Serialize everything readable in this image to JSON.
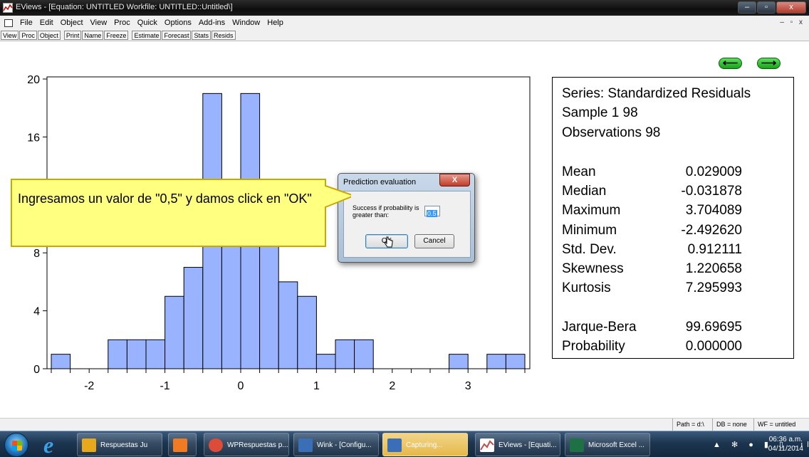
{
  "window": {
    "title": "EViews - [Equation: UNTITLED   Workfile: UNTITLED::Untitled\\]",
    "minimize": "–",
    "maximize": "▫",
    "close": "x"
  },
  "menu": {
    "items": [
      "File",
      "Edit",
      "Object",
      "View",
      "Proc",
      "Quick",
      "Options",
      "Add-ins",
      "Window",
      "Help"
    ],
    "mdi_controls": "– ▫ x"
  },
  "toolbar": {
    "buttons": [
      "View",
      "Proc",
      "Object",
      "Print",
      "Name",
      "Freeze",
      "Estimate",
      "Forecast",
      "Stats",
      "Resids"
    ]
  },
  "nav": {
    "back": "⟵",
    "forward": "⟶"
  },
  "chart_data": {
    "type": "bar",
    "subtype": "histogram",
    "bin_width": 0.25,
    "bins": [
      {
        "x0": -2.5,
        "x1": -2.25,
        "count": 1
      },
      {
        "x0": -2.25,
        "x1": -2.0,
        "count": 0
      },
      {
        "x0": -2.0,
        "x1": -1.75,
        "count": 0
      },
      {
        "x0": -1.75,
        "x1": -1.5,
        "count": 2
      },
      {
        "x0": -1.5,
        "x1": -1.25,
        "count": 2
      },
      {
        "x0": -1.25,
        "x1": -1.0,
        "count": 2
      },
      {
        "x0": -1.0,
        "x1": -0.75,
        "count": 5
      },
      {
        "x0": -0.75,
        "x1": -0.5,
        "count": 7
      },
      {
        "x0": -0.5,
        "x1": -0.25,
        "count": 19
      },
      {
        "x0": -0.25,
        "x1": 0.0,
        "count": 9
      },
      {
        "x0": 0.0,
        "x1": 0.25,
        "count": 19
      },
      {
        "x0": 0.25,
        "x1": 0.5,
        "count": 9
      },
      {
        "x0": 0.5,
        "x1": 0.75,
        "count": 6
      },
      {
        "x0": 0.75,
        "x1": 1.0,
        "count": 5
      },
      {
        "x0": 1.0,
        "x1": 1.25,
        "count": 1
      },
      {
        "x0": 1.25,
        "x1": 1.5,
        "count": 2
      },
      {
        "x0": 1.5,
        "x1": 1.75,
        "count": 2
      },
      {
        "x0": 1.75,
        "x1": 2.0,
        "count": 0
      },
      {
        "x0": 2.0,
        "x1": 2.25,
        "count": 0
      },
      {
        "x0": 2.25,
        "x1": 2.5,
        "count": 0
      },
      {
        "x0": 2.5,
        "x1": 2.75,
        "count": 0
      },
      {
        "x0": 2.75,
        "x1": 3.0,
        "count": 1
      },
      {
        "x0": 3.0,
        "x1": 3.25,
        "count": 0
      },
      {
        "x0": 3.25,
        "x1": 3.5,
        "count": 1
      },
      {
        "x0": 3.5,
        "x1": 3.75,
        "count": 1
      }
    ],
    "xlim": [
      -2.6,
      3.8
    ],
    "ylim": [
      0,
      20
    ],
    "xticks": [
      -2,
      -1,
      0,
      1,
      2,
      3
    ],
    "yticks": [
      0,
      4,
      8,
      12,
      16,
      20
    ],
    "bar_color": "#99b3ff",
    "grid": false
  },
  "stats": {
    "header": [
      "Series: Standardized Residuals",
      "Sample 1 98",
      "Observations 98"
    ],
    "rows": [
      {
        "label": "Mean",
        "value": "0.029009"
      },
      {
        "label": "Median",
        "value": "-0.031878"
      },
      {
        "label": "Maximum",
        "value": "3.704089"
      },
      {
        "label": "Minimum",
        "value": "-2.492620"
      },
      {
        "label": "Std. Dev.",
        "value": "0.912111"
      },
      {
        "label": "Skewness",
        "value": "1.220658"
      },
      {
        "label": "Kurtosis",
        "value": "7.295993"
      }
    ],
    "tests": [
      {
        "label": "Jarque-Bera",
        "value": "99.69695"
      },
      {
        "label": "Probability",
        "value": "0.000000"
      }
    ]
  },
  "dialog": {
    "title": "Prediction evaluation",
    "close": "X",
    "prompt": "Success if probability is greater than:",
    "value": "0.5",
    "ok": "OK",
    "cancel": "Cancel"
  },
  "callout": {
    "text": "Ingresamos un valor de \"0,5\" y damos click en \"OK\"",
    "fill": "#ffff80",
    "border": "#c9a800"
  },
  "statusbar": {
    "path": "Path = d:\\",
    "db": "DB = none",
    "wf": "WF = untitled"
  },
  "taskbar": {
    "tasks": [
      {
        "label": "Respuestas Ju",
        "color": "#e8a81c"
      },
      {
        "label": "",
        "color": "#f27a22"
      },
      {
        "label": "WPRespuestas p...",
        "color": "#dd4b39"
      },
      {
        "label": "Wink - [Configu...",
        "color": "#3a6fb8"
      },
      {
        "label": "Capturing...",
        "color": "#3a6fb8"
      },
      {
        "label": "EViews - [Equati...",
        "color": "#c0504d"
      },
      {
        "label": "Microsoft Excel ...",
        "color": "#1e7145"
      }
    ],
    "clock_time": "06:36 a.m.",
    "clock_date": "04/11/2014",
    "tray_icons": "▲ ✻ ● ▮ ▯ .ıl ◂)"
  }
}
